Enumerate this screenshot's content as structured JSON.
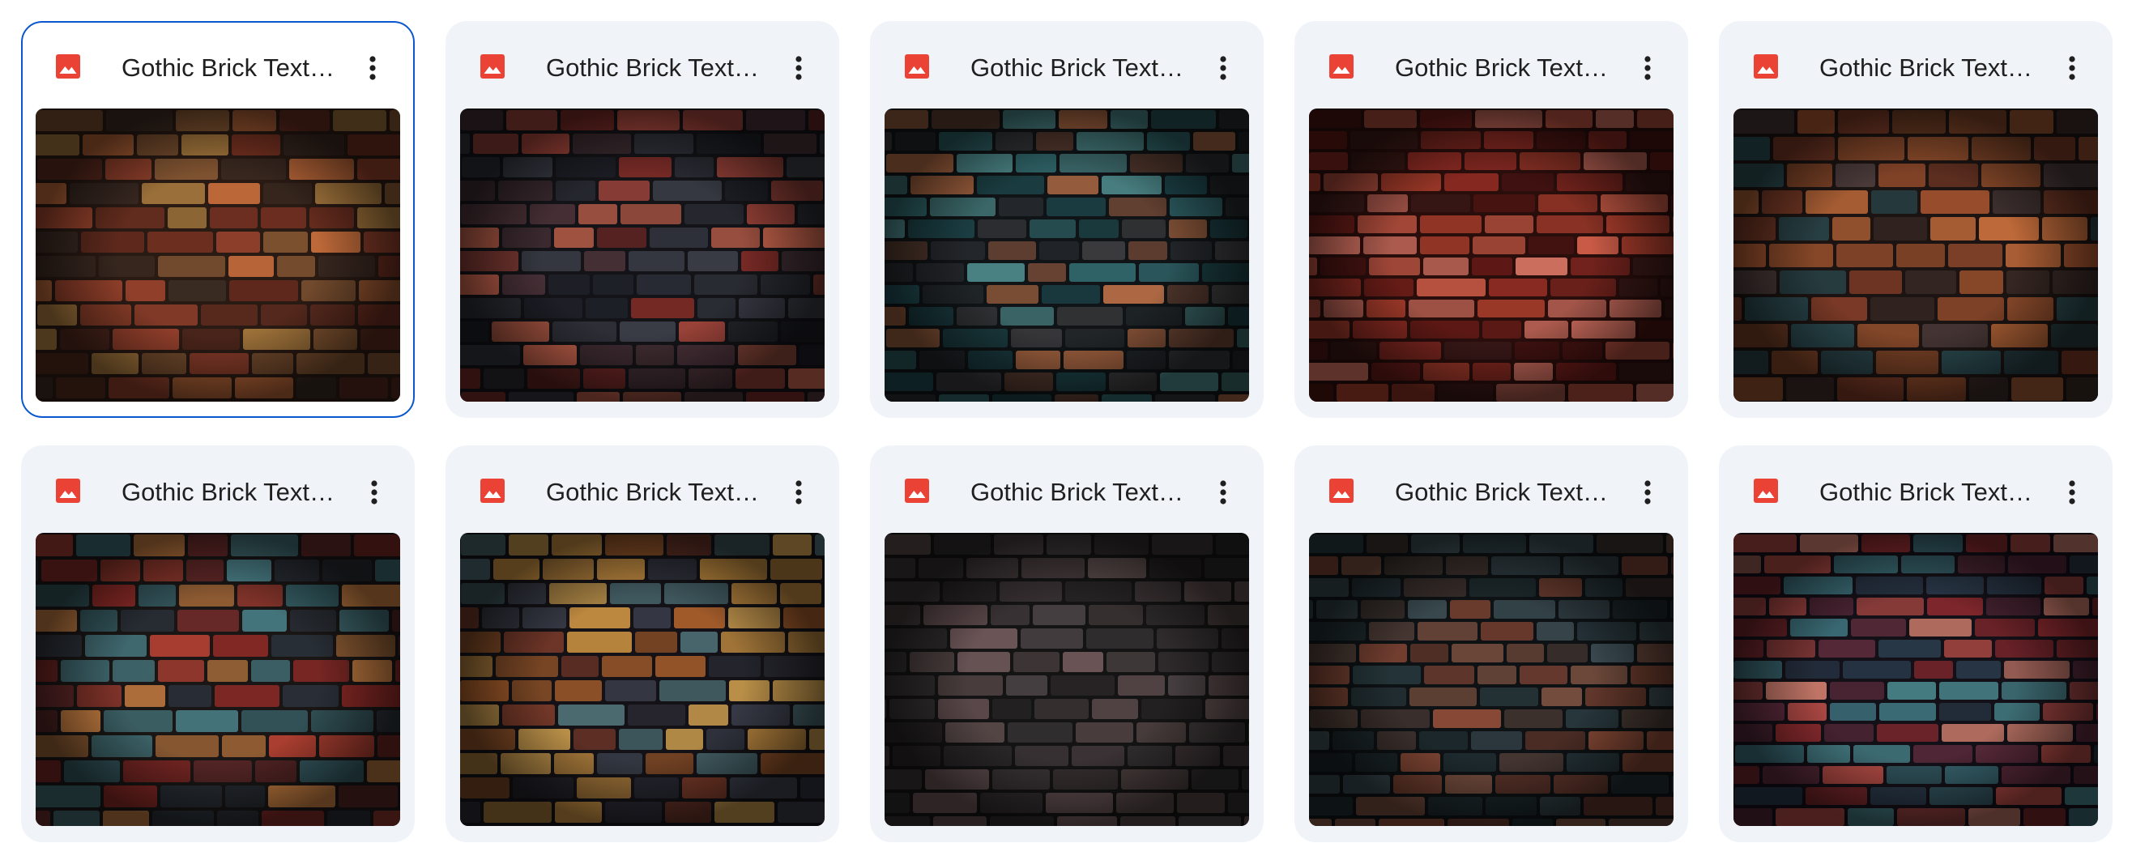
{
  "files": [
    {
      "title": "Gothic Brick Texture",
      "selected": true,
      "palette": {
        "base": "#2a1a14",
        "bricks": [
          "#7a3222",
          "#a0452e",
          "#c06a3a",
          "#5a2a1e",
          "#3a2a22",
          "#8a5a34",
          "#b08040"
        ]
      }
    },
    {
      "title": "Gothic Brick Texture",
      "selected": false,
      "palette": {
        "base": "#141418",
        "bricks": [
          "#2a2c34",
          "#3a3c46",
          "#7a2a26",
          "#a0443a",
          "#4a3238",
          "#1e2028",
          "#c0604a"
        ]
      }
    },
    {
      "title": "Gothic Brick Texture",
      "selected": false,
      "palette": {
        "base": "#101416",
        "bricks": [
          "#1e4a50",
          "#2e6266",
          "#3a3a3c",
          "#6a4434",
          "#b06a44",
          "#24282c",
          "#4a8486"
        ]
      }
    },
    {
      "title": "Gothic Brick Texture",
      "selected": false,
      "palette": {
        "base": "#2a0e0c",
        "bricks": [
          "#8a2a22",
          "#b0402e",
          "#c85a46",
          "#6a1c18",
          "#4a1412",
          "#d07060",
          "#3a1a18"
        ]
      }
    },
    {
      "title": "Gothic Brick Texture",
      "selected": false,
      "palette": {
        "base": "#1c1412",
        "bricks": [
          "#7a3a26",
          "#a0522e",
          "#c06a3a",
          "#4a3a3a",
          "#2a4a50",
          "#8a4a2a",
          "#3a2a26"
        ]
      }
    },
    {
      "title": "Gothic Brick Texture",
      "selected": false,
      "palette": {
        "base": "#1a1616",
        "bricks": [
          "#3a6870",
          "#4a8088",
          "#8a2a26",
          "#b04032",
          "#c07a40",
          "#2a3038",
          "#6a2a2a"
        ]
      }
    },
    {
      "title": "Gothic Brick Texture",
      "selected": false,
      "palette": {
        "base": "#141216",
        "bricks": [
          "#a05a2a",
          "#c08a40",
          "#3a3e4a",
          "#4a6a70",
          "#7a3a2a",
          "#2a2a34",
          "#d0a050"
        ]
      }
    },
    {
      "title": "Gothic Brick Texture",
      "selected": false,
      "palette": {
        "base": "#141414",
        "bricks": [
          "#3a3436",
          "#4a4244",
          "#5a4a4a",
          "#2a2628",
          "#6a5456",
          "#322e30",
          "#443a3c"
        ]
      }
    },
    {
      "title": "Gothic Brick Texture",
      "selected": false,
      "palette": {
        "base": "#0e1214",
        "bricks": [
          "#6a3a2e",
          "#8a4a36",
          "#2a3a40",
          "#3a4a50",
          "#4a3a34",
          "#1e2a2e",
          "#7a5040"
        ]
      }
    },
    {
      "title": "Gothic Brick Texture",
      "selected": false,
      "palette": {
        "base": "#141018",
        "bricks": [
          "#8a2a2e",
          "#b04a44",
          "#3a6a74",
          "#c87a6a",
          "#5a2a3a",
          "#2a3a4a",
          "#4a8a90"
        ]
      }
    }
  ],
  "colors": {
    "accent": "#0b57d0",
    "card_bg": "#f0f4f9",
    "image_icon": "#ea4335",
    "menu_icon": "#1f1f1f"
  },
  "icons": {
    "file_type": "image-file-icon",
    "menu": "more-vert-icon"
  }
}
